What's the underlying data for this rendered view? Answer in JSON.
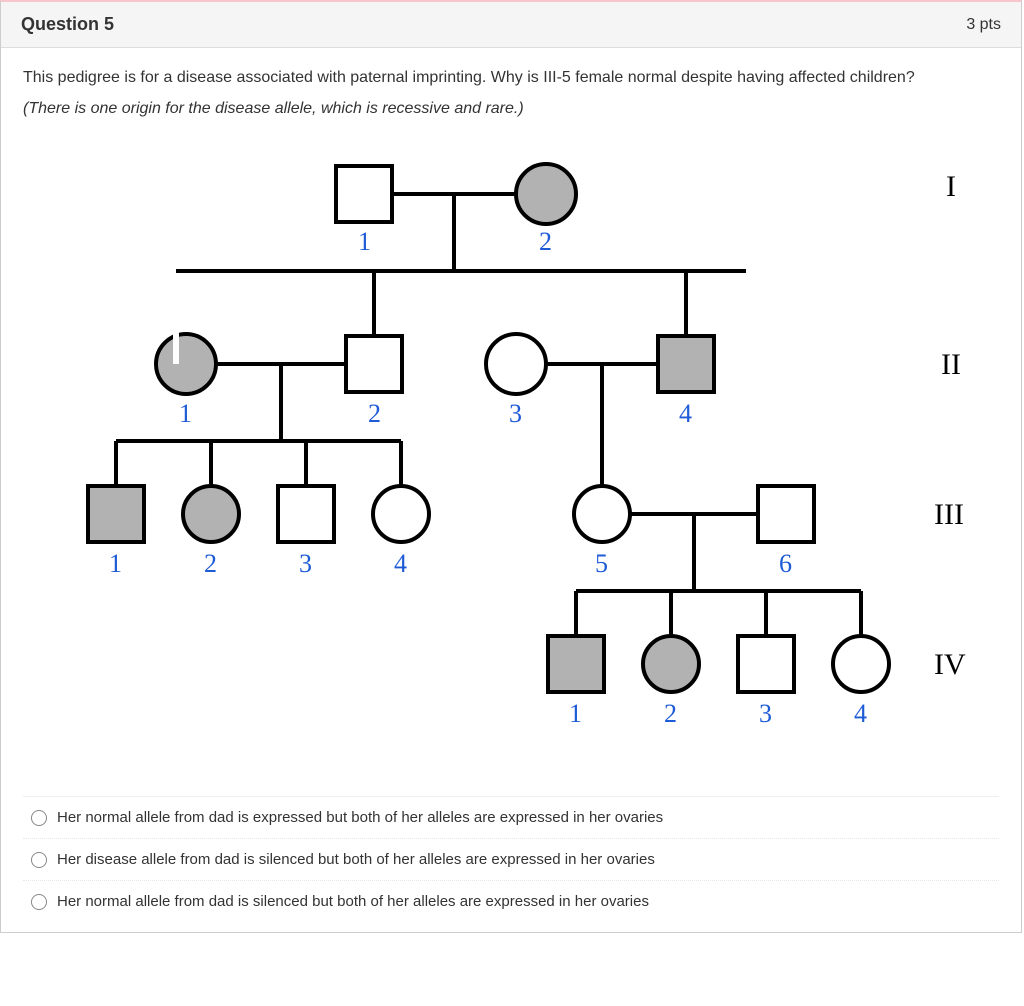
{
  "question": {
    "title": "Question 5",
    "points": "3 pts",
    "text": "This pedigree is for a disease associated with paternal imprinting. Why is III-5 female normal despite having affected children?",
    "note": "(There is one origin for the disease allele, which is recessive and rare.)"
  },
  "generations": {
    "I": "I",
    "II": "II",
    "III": "III",
    "IV": "IV"
  },
  "labels": {
    "I1": "1",
    "I2": "2",
    "II1": "1",
    "II2": "2",
    "II3": "3",
    "II4": "4",
    "III1": "1",
    "III2": "2",
    "III3": "3",
    "III4": "4",
    "III5": "5",
    "III6": "6",
    "IV1": "1",
    "IV2": "2",
    "IV3": "3",
    "IV4": "4"
  },
  "answers": {
    "a": "Her normal allele from dad is expressed but both of her alleles are expressed in her ovaries",
    "b": "Her disease allele from dad is silenced but both of her alleles are expressed in her ovaries",
    "c": "Her normal allele from dad is silenced but both of her alleles are expressed in her ovaries"
  },
  "chart_data": {
    "type": "diagram",
    "note": "Pedigree chart. square=male, circle=female, grey fill=affected, white fill=unaffected.",
    "individuals": [
      {
        "id": "I-1",
        "gen": "I",
        "sex": "M",
        "affected": false
      },
      {
        "id": "I-2",
        "gen": "I",
        "sex": "F",
        "affected": true
      },
      {
        "id": "II-1",
        "gen": "II",
        "sex": "F",
        "affected": true
      },
      {
        "id": "II-2",
        "gen": "II",
        "sex": "M",
        "affected": false
      },
      {
        "id": "II-3",
        "gen": "II",
        "sex": "F",
        "affected": false
      },
      {
        "id": "II-4",
        "gen": "II",
        "sex": "M",
        "affected": true
      },
      {
        "id": "III-1",
        "gen": "III",
        "sex": "M",
        "affected": true
      },
      {
        "id": "III-2",
        "gen": "III",
        "sex": "F",
        "affected": true
      },
      {
        "id": "III-3",
        "gen": "III",
        "sex": "M",
        "affected": false
      },
      {
        "id": "III-4",
        "gen": "III",
        "sex": "F",
        "affected": false
      },
      {
        "id": "III-5",
        "gen": "III",
        "sex": "F",
        "affected": false
      },
      {
        "id": "III-6",
        "gen": "III",
        "sex": "M",
        "affected": false
      },
      {
        "id": "IV-1",
        "gen": "IV",
        "sex": "M",
        "affected": true
      },
      {
        "id": "IV-2",
        "gen": "IV",
        "sex": "F",
        "affected": true
      },
      {
        "id": "IV-3",
        "gen": "IV",
        "sex": "M",
        "affected": false
      },
      {
        "id": "IV-4",
        "gen": "IV",
        "sex": "F",
        "affected": false
      }
    ],
    "matings": [
      {
        "parents": [
          "I-1",
          "I-2"
        ],
        "children": [
          "II-2",
          "II-4"
        ]
      },
      {
        "parents": [
          "II-1",
          "II-2"
        ],
        "children": [
          "III-1",
          "III-2",
          "III-3",
          "III-4"
        ]
      },
      {
        "parents": [
          "II-3",
          "II-4"
        ],
        "children": [
          "III-5"
        ]
      },
      {
        "parents": [
          "III-5",
          "III-6"
        ],
        "children": [
          "IV-1",
          "IV-2",
          "IV-3",
          "IV-4"
        ]
      }
    ]
  }
}
